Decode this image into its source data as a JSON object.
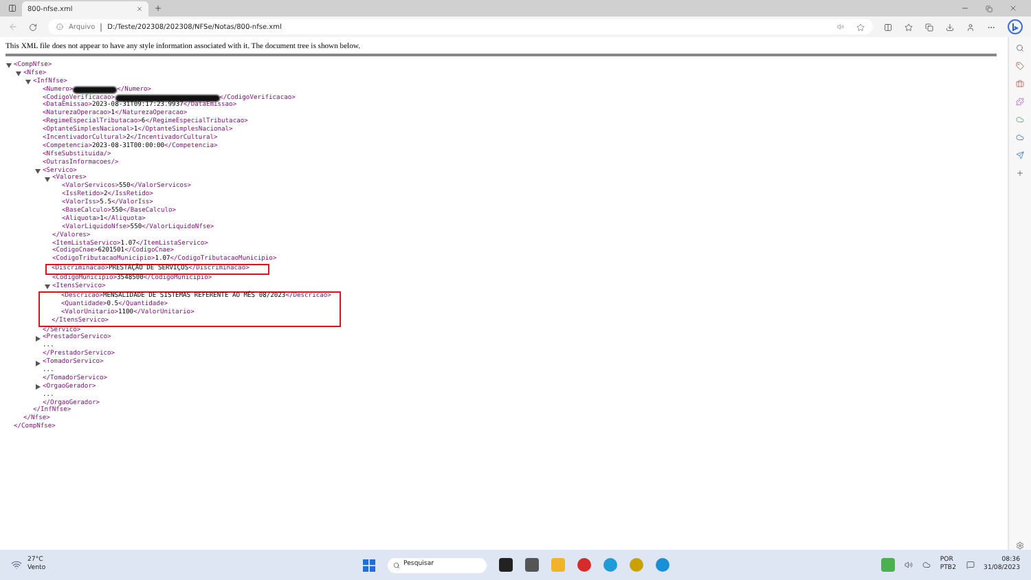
{
  "browser": {
    "tab": {
      "title": "800-nfse.xml",
      "selected": true
    },
    "address": {
      "scheme_label": "Arquivo",
      "url": "D:/Teste/202308/202308/NFSe/Notas/800-nfse.xml"
    }
  },
  "message": "This XML file does not appear to have any style information associated with it. The document tree is shown below.",
  "tree": [
    {
      "open": "<CompNfse>",
      "close": "</CompNfse>",
      "kind": "parent",
      "expanded": true,
      "children": [
        {
          "open": "<Nfse>",
          "close": "</Nfse>",
          "kind": "parent",
          "expanded": true,
          "children": [
            {
              "open": "<InfNfse>",
              "close": "</InfNfse>",
              "kind": "parent",
              "expanded": true,
              "children": [
                {
                  "open": "<Numero>",
                  "close": "</Numero>",
                  "kind": "leaf",
                  "redacted": true
                },
                {
                  "open": "<CodigoVerificacao>",
                  "close": "</CodigoVerificacao>",
                  "kind": "leaf",
                  "redacted": true
                },
                {
                  "open": "<DataEmissao>",
                  "value": "2023-08-31T09:17:23.9937",
                  "close": "</DataEmissao>",
                  "kind": "leaf"
                },
                {
                  "open": "<NaturezaOperacao>",
                  "value": "1",
                  "close": "</NaturezaOperacao>",
                  "kind": "leaf"
                },
                {
                  "open": "<RegimeEspecialTributacao>",
                  "value": "6",
                  "close": "</RegimeEspecialTributacao>",
                  "kind": "leaf"
                },
                {
                  "open": "<OptanteSimplesNacional>",
                  "value": "1",
                  "close": "</OptanteSimplesNacional>",
                  "kind": "leaf"
                },
                {
                  "open": "<IncentivadorCultural>",
                  "value": "2",
                  "close": "</IncentivadorCultural>",
                  "kind": "leaf"
                },
                {
                  "open": "<Competencia>",
                  "value": "2023-08-31T00:00:00",
                  "close": "</Competencia>",
                  "kind": "leaf"
                },
                {
                  "open": "<NfseSubstituida/>",
                  "kind": "empty"
                },
                {
                  "open": "<OutrasInformacoes/>",
                  "kind": "empty"
                },
                {
                  "open": "<Servico>",
                  "close": "</Servico>",
                  "kind": "parent",
                  "expanded": true,
                  "children": [
                    {
                      "open": "<Valores>",
                      "close": "</Valores>",
                      "kind": "parent",
                      "expanded": true,
                      "children": [
                        {
                          "open": "<ValorServicos>",
                          "value": "550",
                          "close": "</ValorServicos>",
                          "kind": "leaf"
                        },
                        {
                          "open": "<IssRetido>",
                          "value": "2",
                          "close": "</IssRetido>",
                          "kind": "leaf"
                        },
                        {
                          "open": "<ValorIss>",
                          "value": "5.5",
                          "close": "</ValorIss>",
                          "kind": "leaf"
                        },
                        {
                          "open": "<BaseCalculo>",
                          "value": "550",
                          "close": "</BaseCalculo>",
                          "kind": "leaf"
                        },
                        {
                          "open": "<Aliquota>",
                          "value": "1",
                          "close": "</Aliquota>",
                          "kind": "leaf"
                        },
                        {
                          "open": "<ValorLiquidoNfse>",
                          "value": "550",
                          "close": "</ValorLiquidoNfse>",
                          "kind": "leaf"
                        }
                      ]
                    },
                    {
                      "open": "<ItemListaServico>",
                      "value": "1.07",
                      "close": "</ItemListaServico>",
                      "kind": "leaf"
                    },
                    {
                      "open": "<CodigoCnae>",
                      "value": "6201501",
                      "close": "</CodigoCnae>",
                      "kind": "leaf"
                    },
                    {
                      "open": "<CodigoTributacaoMunicipio>",
                      "value": "1.07",
                      "close": "</CodigoTributacaoMunicipio>",
                      "kind": "leaf"
                    },
                    {
                      "open": "<Discriminacao>",
                      "value": "PRESTAÇÃO DE SERVIÇOS",
                      "close": "</Discriminacao>",
                      "kind": "leaf",
                      "highlighted": true
                    },
                    {
                      "open": "<CodigoMunicipio>",
                      "value": "3548500",
                      "close": "</CodigoMunicipio>",
                      "kind": "leaf"
                    },
                    {
                      "open": "<ItensServico>",
                      "close": "</ItensServico>",
                      "kind": "parent",
                      "expanded": true,
                      "highlighted": true,
                      "children": [
                        {
                          "open": "<Descricao>",
                          "value": "MENSALIDADE DE SISTEMAS REFERENTE AO MÊS 08/2023",
                          "close": "</Descricao>",
                          "kind": "leaf"
                        },
                        {
                          "open": "<Quantidade>",
                          "value": "0.5",
                          "close": "</Quantidade>",
                          "kind": "leaf"
                        },
                        {
                          "open": "<ValorUnitario>",
                          "value": "1100",
                          "close": "</ValorUnitario>",
                          "kind": "leaf"
                        }
                      ]
                    }
                  ]
                },
                {
                  "open": "<PrestadorServico>",
                  "close": "</PrestadorServico>",
                  "kind": "parent",
                  "expanded": false,
                  "ellipsis": "..."
                },
                {
                  "open": "<TomadorServico>",
                  "close": "</TomadorServico>",
                  "kind": "parent",
                  "expanded": false,
                  "ellipsis": "..."
                },
                {
                  "open": "<OrgaoGerador>",
                  "close": "</OrgaoGerador>",
                  "kind": "parent",
                  "expanded": false,
                  "ellipsis": "..."
                }
              ]
            }
          ]
        }
      ]
    }
  ],
  "taskbar": {
    "weather": {
      "temperature": "27°C",
      "condition": "Vento"
    },
    "search": {
      "placeholder": "Pesquisar"
    },
    "language": {
      "line1": "POR",
      "line2": "PTB2"
    },
    "clock": {
      "time": "08:36",
      "date": "31/08/2023"
    }
  }
}
